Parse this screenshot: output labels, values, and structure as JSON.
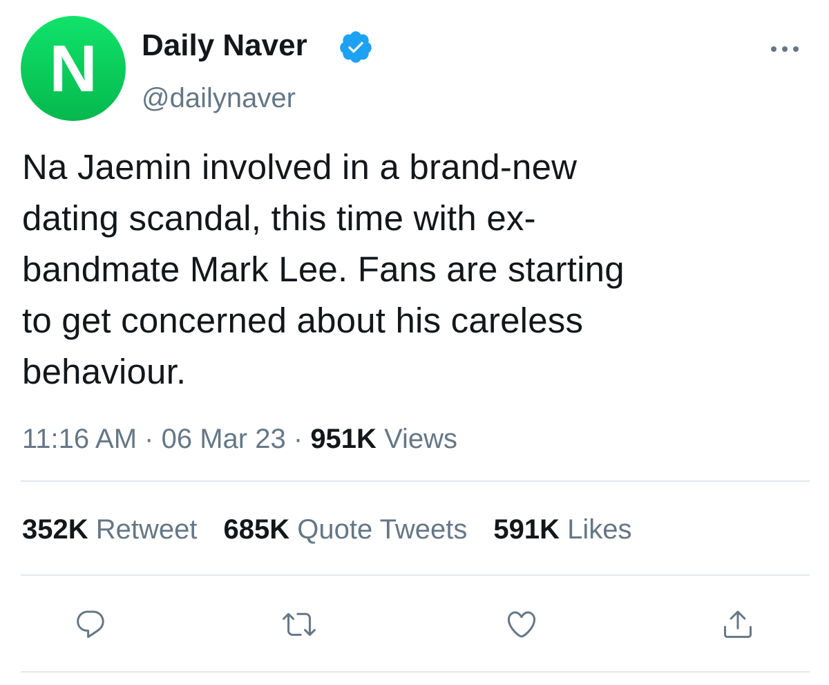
{
  "author": {
    "avatar_letter": "N",
    "display_name": "Daily Naver",
    "handle": "@dailynaver",
    "verified": true,
    "avatar_color": "#0ccf5d"
  },
  "tweet": {
    "lines": [
      "Na Jaemin involved in a brand-new",
      "dating scandal, this time with ex-",
      "bandmate Mark Lee. Fans are starting",
      "to get concerned about his careless",
      "behaviour."
    ],
    "time": "11:16 AM",
    "separator": "·",
    "date": "06 Mar 23",
    "views_count": "951K",
    "views_label": "Views"
  },
  "stats": {
    "retweets_count": "352K",
    "retweets_label": "Retweet",
    "quotes_count": "685K",
    "quotes_label": "Quote Tweets",
    "likes_count": "591K",
    "likes_label": "Likes"
  },
  "icons": {
    "more": "more-options-icon",
    "verified": "verified-badge-icon",
    "reply": "reply-icon",
    "retweet": "retweet-icon",
    "like": "heart-icon",
    "share": "share-icon"
  },
  "colors": {
    "text": "#14171a",
    "secondary": "#657786",
    "verified_blue": "#1da1f2",
    "divider": "#e1e8ed"
  }
}
